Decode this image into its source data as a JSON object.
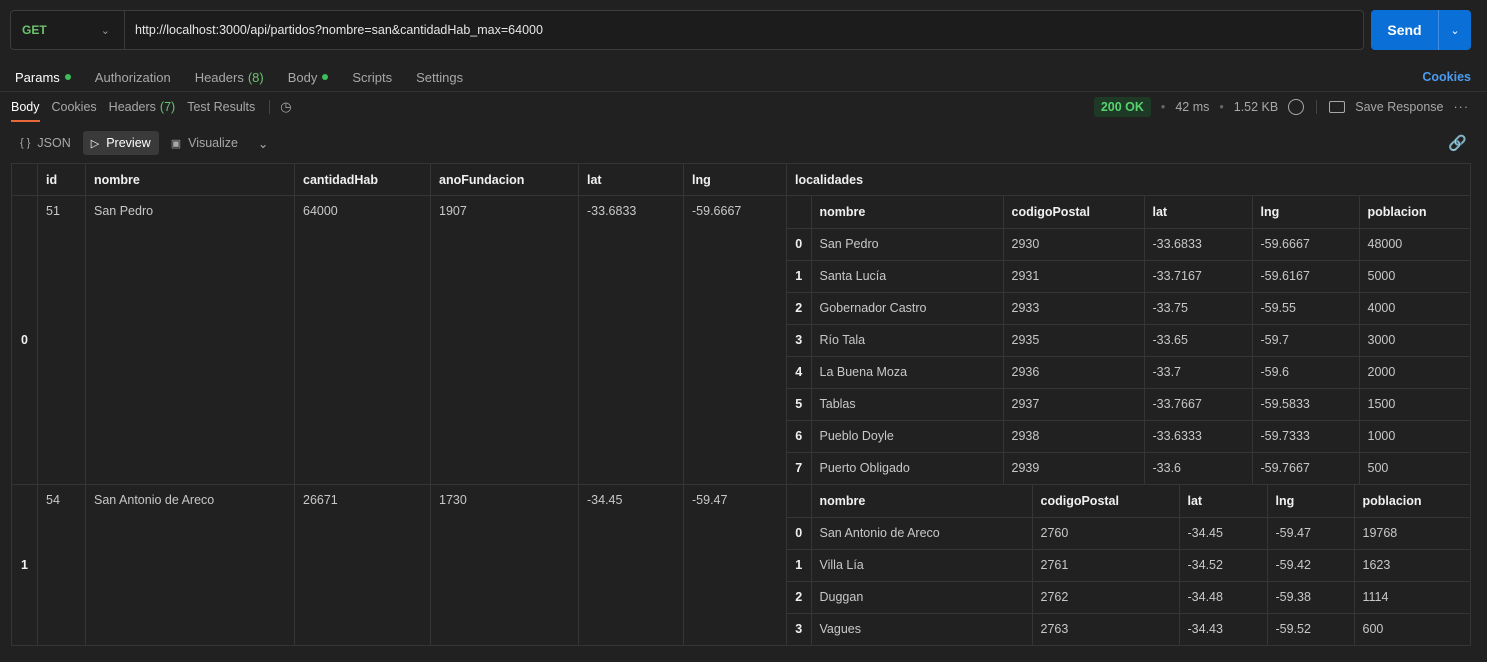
{
  "request": {
    "method": "GET",
    "url": "http://localhost:3000/api/partidos?nombre=san&cantidadHab_max=64000",
    "send_label": "Send"
  },
  "request_tabs": [
    {
      "label": "Params",
      "dot": true
    },
    {
      "label": "Authorization"
    },
    {
      "label": "Headers",
      "count": "(8)"
    },
    {
      "label": "Body",
      "dot": true
    },
    {
      "label": "Scripts"
    },
    {
      "label": "Settings"
    }
  ],
  "cookies_link": "Cookies",
  "response_tabs": [
    {
      "label": "Body"
    },
    {
      "label": "Cookies"
    },
    {
      "label": "Headers",
      "count": "(7)"
    },
    {
      "label": "Test Results"
    }
  ],
  "status": {
    "code": "200 OK",
    "time": "42 ms",
    "size": "1.52 KB",
    "save_label": "Save Response"
  },
  "view_modes": {
    "json": "JSON",
    "preview": "Preview",
    "visualize": "Visualize"
  },
  "table": {
    "headers": [
      "id",
      "nombre",
      "cantidadHab",
      "anoFundacion",
      "lat",
      "lng",
      "localidades"
    ],
    "inner_headers": [
      "nombre",
      "codigoPostal",
      "lat",
      "lng",
      "poblacion"
    ],
    "rows": [
      {
        "index": "0",
        "id": "51",
        "nombre": "San Pedro",
        "cantidadHab": "64000",
        "anoFundacion": "1907",
        "lat": "-33.6833",
        "lng": "-59.6667",
        "localidades": [
          {
            "i": "0",
            "nombre": "San Pedro",
            "codigoPostal": "2930",
            "lat": "-33.6833",
            "lng": "-59.6667",
            "poblacion": "48000"
          },
          {
            "i": "1",
            "nombre": "Santa Lucía",
            "codigoPostal": "2931",
            "lat": "-33.7167",
            "lng": "-59.6167",
            "poblacion": "5000"
          },
          {
            "i": "2",
            "nombre": "Gobernador Castro",
            "codigoPostal": "2933",
            "lat": "-33.75",
            "lng": "-59.55",
            "poblacion": "4000"
          },
          {
            "i": "3",
            "nombre": "Río Tala",
            "codigoPostal": "2935",
            "lat": "-33.65",
            "lng": "-59.7",
            "poblacion": "3000"
          },
          {
            "i": "4",
            "nombre": "La Buena Moza",
            "codigoPostal": "2936",
            "lat": "-33.7",
            "lng": "-59.6",
            "poblacion": "2000"
          },
          {
            "i": "5",
            "nombre": "Tablas",
            "codigoPostal": "2937",
            "lat": "-33.7667",
            "lng": "-59.5833",
            "poblacion": "1500"
          },
          {
            "i": "6",
            "nombre": "Pueblo Doyle",
            "codigoPostal": "2938",
            "lat": "-33.6333",
            "lng": "-59.7333",
            "poblacion": "1000"
          },
          {
            "i": "7",
            "nombre": "Puerto Obligado",
            "codigoPostal": "2939",
            "lat": "-33.6",
            "lng": "-59.7667",
            "poblacion": "500"
          }
        ]
      },
      {
        "index": "1",
        "id": "54",
        "nombre": "San Antonio de Areco",
        "cantidadHab": "26671",
        "anoFundacion": "1730",
        "lat": "-34.45",
        "lng": "-59.47",
        "localidades": [
          {
            "i": "0",
            "nombre": "San Antonio de Areco",
            "codigoPostal": "2760",
            "lat": "-34.45",
            "lng": "-59.47",
            "poblacion": "19768"
          },
          {
            "i": "1",
            "nombre": "Villa Lía",
            "codigoPostal": "2761",
            "lat": "-34.52",
            "lng": "-59.42",
            "poblacion": "1623"
          },
          {
            "i": "2",
            "nombre": "Duggan",
            "codigoPostal": "2762",
            "lat": "-34.48",
            "lng": "-59.38",
            "poblacion": "1114"
          },
          {
            "i": "3",
            "nombre": "Vagues",
            "codigoPostal": "2763",
            "lat": "-34.43",
            "lng": "-59.52",
            "poblacion": "600"
          }
        ]
      }
    ]
  }
}
